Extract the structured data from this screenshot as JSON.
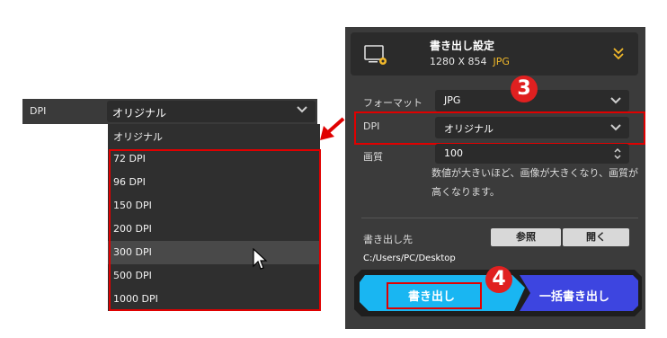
{
  "left_dropdown": {
    "label": "DPI",
    "selected": "オリジナル",
    "options": [
      "オリジナル",
      "72 DPI",
      "96 DPI",
      "150 DPI",
      "200 DPI",
      "300 DPI",
      "500 DPI",
      "1000 DPI"
    ],
    "hovered_option": "300 DPI"
  },
  "panel": {
    "title": "書き出し設定",
    "resolution": "1280 X 854",
    "format_badge": "JPG",
    "format_label": "フォーマット",
    "format_value": "JPG",
    "dpi_label": "DPI",
    "dpi_value": "オリジナル",
    "quality_label": "画質",
    "quality_value": "100",
    "quality_desc": "数値が大きいほど、画像が大きくなり、画質が高くなります。",
    "dest_label": "書き出し先",
    "browse_button": "参照",
    "open_button": "開く",
    "path": "C:/Users/PC/Desktop",
    "export_button": "書き出し",
    "batch_export_button": "一括書き出し"
  },
  "badges": {
    "step3": "3",
    "step4": "4"
  },
  "colors": {
    "highlight_border": "#e00000",
    "format_accent": "#f2b92b",
    "export_cyan": "#19b6f2",
    "batch_blue": "#3d45e0"
  },
  "icons": [
    "monitor-gear-icon",
    "double-chevron-down-icon",
    "chevron-down-icon",
    "stepper-icon",
    "red-arrow-icon",
    "mouse-cursor-icon"
  ]
}
